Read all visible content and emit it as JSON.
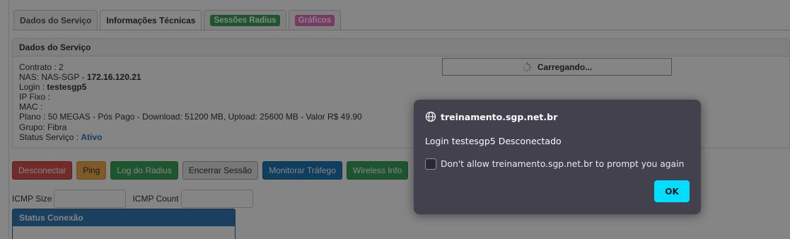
{
  "tabs": [
    {
      "label": "Dados do Serviço"
    },
    {
      "label": "Informações Técnicas"
    },
    {
      "label": "Sessões Radius"
    },
    {
      "label": "Gráficos"
    }
  ],
  "panel": {
    "title": "Dados do Serviço",
    "contrato": "Contrato : 2",
    "nas_label": "NAS: NAS-SGP - ",
    "nas_ip": "172.16.120.21",
    "login_label": "Login : ",
    "login_value": "testesgp5",
    "ip_fixo": "IP Fixo :",
    "mac": "MAC :",
    "plano": "Plano : 50 MEGAS - Pós Pago - Download: 51200 MB, Upload: 25600 MB - Valor R$ 49.90",
    "grupo": "Grupo: Fibra",
    "status_label": "Status Serviço : ",
    "status_value": "Ativo"
  },
  "loading": {
    "text": "Carregando..."
  },
  "actions": {
    "desconectar": "Desconectar",
    "ping": "Ping",
    "log_radius": "Log do Radius",
    "encerrar": "Encerrar Sessão",
    "monitorar": "Monitorar Tráfego",
    "wireless": "Wireless Info"
  },
  "icmp": {
    "size_label": "ICMP Size",
    "count_label": "ICMP Count"
  },
  "status_conexao": {
    "title": "Status Conexão"
  },
  "dialog": {
    "host": "treinamento.sgp.net.br",
    "message": "Login testesgp5 Desconectado",
    "checkbox_label": "Don't allow treinamento.sgp.net.br to prompt you again",
    "ok": "OK"
  },
  "colors": {
    "accent": "#00ddff",
    "dialog_bg": "#42414d",
    "status_active": "#2a7ab9"
  }
}
